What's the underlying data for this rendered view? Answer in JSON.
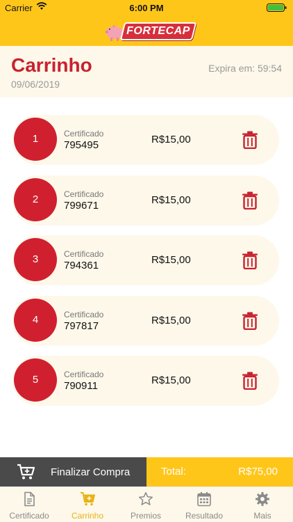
{
  "status_bar": {
    "carrier": "Carrier",
    "time": "6:00 PM"
  },
  "brand": {
    "logo_text": "FORTECAP",
    "icon": "piggy-bank-icon"
  },
  "cart": {
    "title": "Carrinho",
    "date": "09/06/2019",
    "expire": "Expira em: 59:54"
  },
  "items": [
    {
      "index": "1",
      "label": "Certificado",
      "number": "795495",
      "price": "R$15,00"
    },
    {
      "index": "2",
      "label": "Certificado",
      "number": "799671",
      "price": "R$15,00"
    },
    {
      "index": "3",
      "label": "Certificado",
      "number": "794361",
      "price": "R$15,00"
    },
    {
      "index": "4",
      "label": "Certificado",
      "number": "797817",
      "price": "R$15,00"
    },
    {
      "index": "5",
      "label": "Certificado",
      "number": "790911",
      "price": "R$15,00"
    }
  ],
  "footer": {
    "finalize_label": "Finalizar Compra",
    "total_label": "Total:",
    "total_value": "R$75,00"
  },
  "tabs": [
    {
      "label": "Certificado",
      "icon": "document-icon",
      "active": false
    },
    {
      "label": "Carrinho",
      "icon": "cart-icon",
      "active": true
    },
    {
      "label": "Premios",
      "icon": "star-icon",
      "active": false
    },
    {
      "label": "Resultado",
      "icon": "calendar-icon",
      "active": false
    },
    {
      "label": "Mais",
      "icon": "gear-icon",
      "active": false
    }
  ],
  "colors": {
    "accent_yellow": "#ffc61a",
    "brand_red": "#d0202f",
    "card_background": "#fdf8ea",
    "dark_button": "#4a4a4a"
  }
}
